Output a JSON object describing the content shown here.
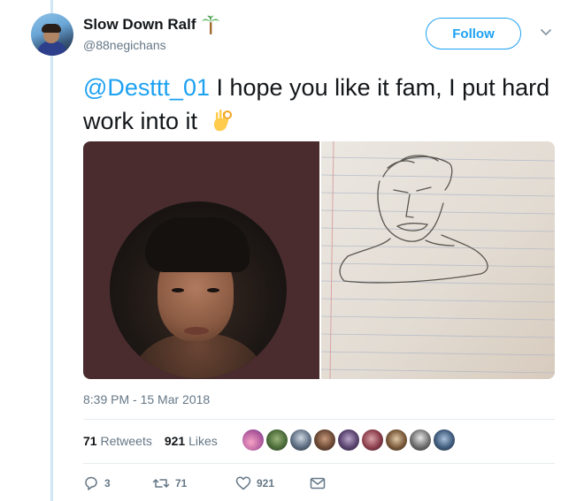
{
  "user": {
    "display_name": "Slow Down Ralf",
    "handle": "@88negichans",
    "name_emoji": "palm-tree-icon"
  },
  "follow_button": {
    "label": "Follow"
  },
  "tweet": {
    "mention": "@Desttt_01",
    "text": " I hope you like it fam, I put hard work into it",
    "trailing_emoji": "ok-hand-icon",
    "timestamp": "8:39 PM - 15 Mar 2018"
  },
  "stats": {
    "retweets_count": "71",
    "retweets_label": "Retweets",
    "likes_count": "921",
    "likes_label": "Likes"
  },
  "actions": {
    "reply_count": "3",
    "retweet_count": "71",
    "like_count": "921"
  },
  "colors": {
    "accent": "#1da1f2",
    "muted": "#657786",
    "text": "#14171a"
  }
}
